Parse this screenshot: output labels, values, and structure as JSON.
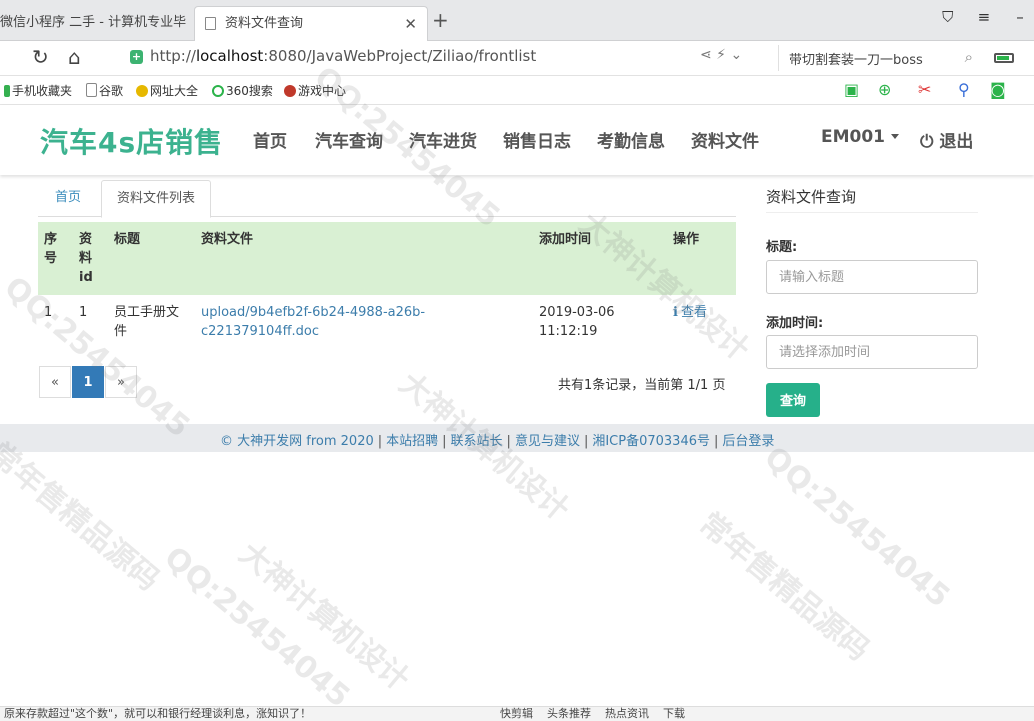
{
  "browser": {
    "tabs": [
      {
        "title": "微信小程序 二手 - 计算机专业毕",
        "active": false
      },
      {
        "title": "资料文件查询",
        "active": true
      }
    ],
    "url_prefix": "http://",
    "url_host": "localhost",
    "url_path": ":8080/JavaWebProject/Ziliao/frontlist",
    "search_text": "带切割套装一刀一boss",
    "bookmarks": [
      "手机收藏夹",
      "谷歌",
      "网址大全",
      "360搜索",
      "游戏中心"
    ]
  },
  "site": {
    "brand": "汽车4s店销售",
    "nav": [
      "首页",
      "汽车查询",
      "汽车进货",
      "销售日志",
      "考勤信息",
      "资料文件"
    ],
    "user": "EM001",
    "logout": "退出"
  },
  "breadcrumb": {
    "home": "首页",
    "current": "资料文件列表"
  },
  "table": {
    "headers": [
      "序号",
      "资料id",
      "标题",
      "资料文件",
      "添加时间",
      "操作"
    ],
    "rows": [
      {
        "index": "1",
        "id": "1",
        "title": "员工手册文件",
        "file": "upload/9b4efb2f-6b24-4988-a26b-c221379104ff.doc",
        "time": "2019-03-06 11:12:19",
        "action": "查看"
      }
    ]
  },
  "pagination": {
    "prev": "«",
    "current": "1",
    "next": "»"
  },
  "records_text": "共有1条记录，当前第 1/1 页",
  "sidebar": {
    "title": "资料文件查询",
    "title_label": "标题:",
    "title_placeholder": "请输入标题",
    "time_label": "添加时间:",
    "time_placeholder": "请选择添加时间",
    "query_button": "查询"
  },
  "footer": {
    "copyright": "© 大神开发网 from 2020",
    "links": [
      "本站招聘",
      "联系站长",
      "意见与建议",
      "湘ICP备0703346号",
      "后台登录"
    ]
  },
  "statusbar": {
    "left": "原来存款超过\"这个数\"，就可以和银行经理谈利息，涨知识了！",
    "right_items": [
      "快剪辑",
      "头条推荐",
      "热点资讯",
      "下载"
    ]
  },
  "watermark": [
    "大神计算机设计",
    "QQ:25454045",
    "常年售精品源码"
  ],
  "colors": {
    "brand": "#3cb28f",
    "table_header_bg": "#d9f0d3",
    "query_button": "#26b08a",
    "link": "#3c7dab",
    "active_page": "#337ab7"
  }
}
